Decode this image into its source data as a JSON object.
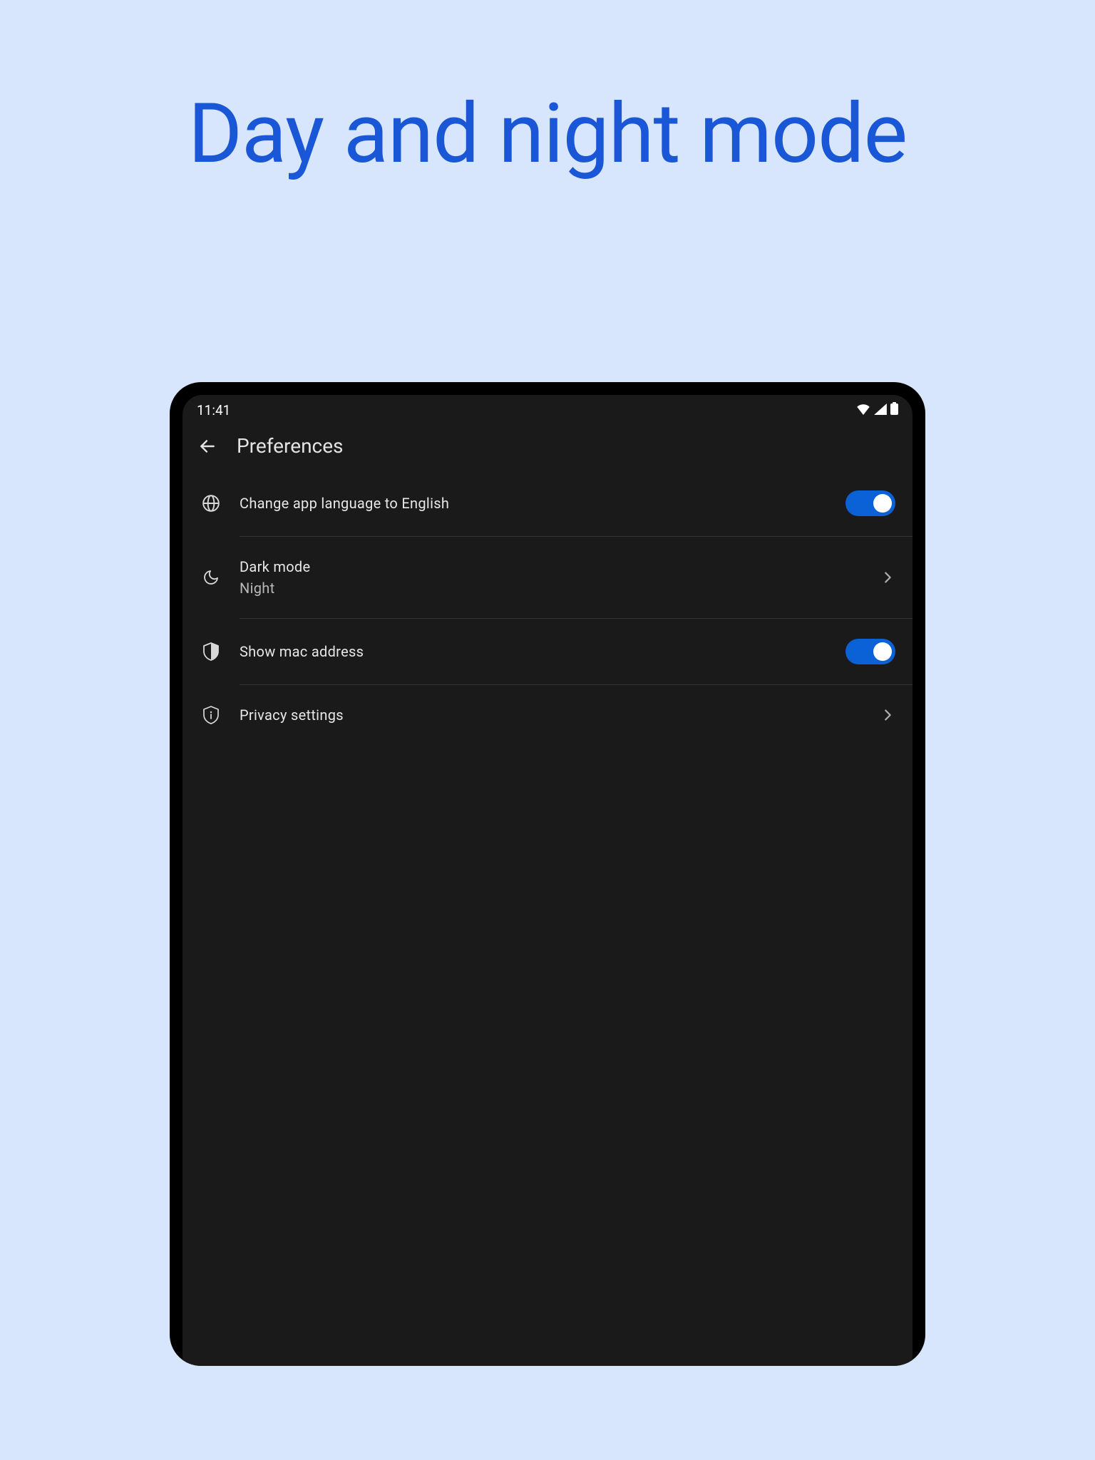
{
  "hero": "Day and night mode",
  "status": {
    "time": "11:41"
  },
  "appbar": {
    "title": "Preferences"
  },
  "rows": {
    "lang": {
      "title": "Change app language to English"
    },
    "dark": {
      "title": "Dark mode",
      "sub": "Night"
    },
    "mac": {
      "title": "Show mac address"
    },
    "priv": {
      "title": "Privacy settings"
    }
  }
}
